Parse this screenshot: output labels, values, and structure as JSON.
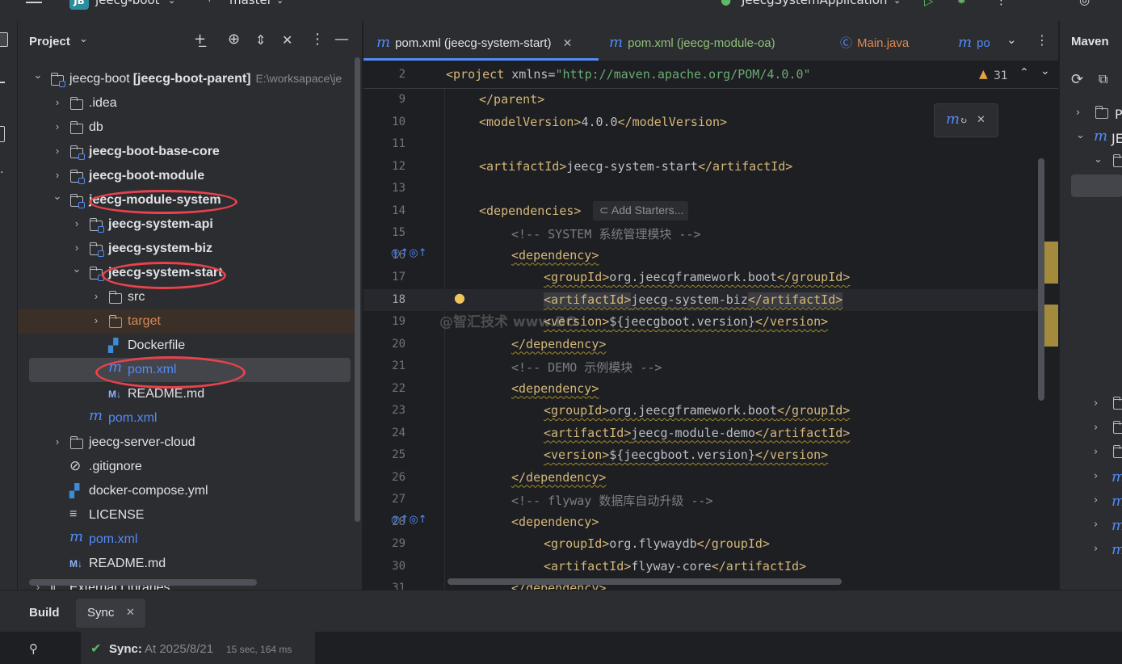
{
  "titlebar": {
    "project_badge": "JB",
    "project_name": "jeecg-boot",
    "branch": "master",
    "run_config": "JeecgSystemApplication"
  },
  "project_panel": {
    "title": "Project",
    "tree": [
      {
        "label": "jeecg-boot",
        "suffix": "[jeecg-boot-parent]",
        "path": "E:\\worksapace\\je",
        "depth": 0,
        "expanded": true,
        "icon": "module-folder-icon"
      },
      {
        "label": ".idea",
        "depth": 1,
        "expanded": false,
        "icon": "folder-icon"
      },
      {
        "label": "db",
        "depth": 1,
        "expanded": false,
        "icon": "folder-icon"
      },
      {
        "label": "jeecg-boot-base-core",
        "depth": 1,
        "expanded": false,
        "icon": "module-folder-icon",
        "bold": true
      },
      {
        "label": "jeecg-boot-module",
        "depth": 1,
        "expanded": false,
        "icon": "module-folder-icon",
        "bold": true
      },
      {
        "label": "jeecg-module-system",
        "depth": 1,
        "expanded": true,
        "icon": "module-folder-icon",
        "bold": true,
        "circled": true
      },
      {
        "label": "jeecg-system-api",
        "depth": 2,
        "expanded": false,
        "icon": "module-folder-icon",
        "bold": true
      },
      {
        "label": "jeecg-system-biz",
        "depth": 2,
        "expanded": false,
        "icon": "module-folder-icon",
        "bold": true
      },
      {
        "label": "jeecg-system-start",
        "depth": 2,
        "expanded": true,
        "icon": "module-folder-icon",
        "bold": true,
        "circled": true
      },
      {
        "label": "src",
        "depth": 3,
        "expanded": false,
        "icon": "folder-icon"
      },
      {
        "label": "target",
        "depth": 3,
        "expanded": false,
        "icon": "folder-icon",
        "excluded": true
      },
      {
        "label": "Dockerfile",
        "depth": 3,
        "icon": "docker-icon"
      },
      {
        "label": "pom.xml",
        "depth": 3,
        "icon": "maven-icon",
        "selected": true,
        "circled": true
      },
      {
        "label": "README.md",
        "depth": 3,
        "icon": "markdown-icon"
      },
      {
        "label": "pom.xml",
        "depth": 2,
        "icon": "maven-icon"
      },
      {
        "label": "jeecg-server-cloud",
        "depth": 1,
        "expanded": false,
        "icon": "folder-icon"
      },
      {
        "label": ".gitignore",
        "depth": 1,
        "icon": "ignore-icon"
      },
      {
        "label": "docker-compose.yml",
        "depth": 1,
        "icon": "docker-icon"
      },
      {
        "label": "LICENSE",
        "depth": 1,
        "icon": "text-icon"
      },
      {
        "label": "pom.xml",
        "depth": 1,
        "icon": "maven-icon"
      },
      {
        "label": "README.md",
        "depth": 1,
        "icon": "markdown-icon"
      },
      {
        "label": "External Libraries",
        "depth": 0,
        "expanded": false,
        "icon": "library-icon"
      }
    ]
  },
  "editor": {
    "tabs": [
      {
        "label": "pom.xml (jeecg-system-start)",
        "active": true,
        "icon": "maven-icon"
      },
      {
        "label": "pom.xml (jeecg-module-oa)",
        "icon": "maven-icon"
      },
      {
        "label": "Main.java",
        "icon": "java-class-icon"
      },
      {
        "label": "po",
        "icon": "maven-icon"
      }
    ],
    "warnings_count": "31",
    "sticky_line": {
      "number": "2",
      "text_tag_open": "<project ",
      "attr": "xmlns=",
      "value": "\"http://maven.apache.org/POM/4.0.0\""
    },
    "add_starters": "Add Starters...",
    "watermark": "@智汇技术  www.BO",
    "lines": [
      {
        "n": "9",
        "indent": 1,
        "parts": [
          [
            "tag",
            "</parent>"
          ]
        ]
      },
      {
        "n": "10",
        "indent": 1,
        "parts": [
          [
            "tag",
            "<modelVersion>"
          ],
          [
            "txt",
            "4.0.0"
          ],
          [
            "tag",
            "</modelVersion>"
          ]
        ]
      },
      {
        "n": "11",
        "indent": 0,
        "parts": []
      },
      {
        "n": "12",
        "indent": 1,
        "parts": [
          [
            "tag",
            "<artifactId>"
          ],
          [
            "txt",
            "jeecg-system-start"
          ],
          [
            "tag",
            "</artifactId>"
          ]
        ]
      },
      {
        "n": "13",
        "indent": 0,
        "parts": []
      },
      {
        "n": "14",
        "indent": 1,
        "parts": [
          [
            "tag",
            "<dependencies>"
          ]
        ],
        "starters": true
      },
      {
        "n": "15",
        "indent": 2,
        "parts": [
          [
            "cm",
            "<!-- SYSTEM 系统管理模块 -->"
          ]
        ]
      },
      {
        "n": "16",
        "indent": 2,
        "parts": [
          [
            "tag",
            "<dependency>"
          ]
        ],
        "gutter": true,
        "wavy": true
      },
      {
        "n": "17",
        "indent": 3,
        "parts": [
          [
            "tag",
            "<groupId>"
          ],
          [
            "txt",
            "org.jeecgframework.boot"
          ],
          [
            "tag",
            "</groupId>"
          ]
        ],
        "wavy": true
      },
      {
        "n": "18",
        "indent": 3,
        "parts": [
          [
            "tag",
            "<artifactId>"
          ],
          [
            "txt",
            "jeecg-system-biz"
          ],
          [
            "tag",
            "</artifactId>"
          ]
        ],
        "current": true,
        "wavy": true,
        "bulb": true
      },
      {
        "n": "19",
        "indent": 3,
        "parts": [
          [
            "tag",
            "<version>"
          ],
          [
            "txt",
            "${jeecgboot.version}"
          ],
          [
            "tag",
            "</version>"
          ]
        ],
        "wavy": true
      },
      {
        "n": "20",
        "indent": 2,
        "parts": [
          [
            "tag",
            "</dependency>"
          ]
        ],
        "wavy": true
      },
      {
        "n": "21",
        "indent": 2,
        "parts": [
          [
            "cm",
            "<!-- DEMO 示例模块 -->"
          ]
        ]
      },
      {
        "n": "22",
        "indent": 2,
        "parts": [
          [
            "tag",
            "<dependency>"
          ]
        ],
        "wavy": true
      },
      {
        "n": "23",
        "indent": 3,
        "parts": [
          [
            "tag",
            "<groupId>"
          ],
          [
            "txt",
            "org.jeecgframework.boot"
          ],
          [
            "tag",
            "</groupId>"
          ]
        ],
        "wavy": true
      },
      {
        "n": "24",
        "indent": 3,
        "parts": [
          [
            "tag",
            "<artifactId>"
          ],
          [
            "txt",
            "jeecg-module-demo"
          ],
          [
            "tag",
            "</artifactId>"
          ]
        ],
        "wavy": true
      },
      {
        "n": "25",
        "indent": 3,
        "parts": [
          [
            "tag",
            "<version>"
          ],
          [
            "txt",
            "${jeecgboot.version}"
          ],
          [
            "tag",
            "</version>"
          ]
        ],
        "wavy": true
      },
      {
        "n": "26",
        "indent": 2,
        "parts": [
          [
            "tag",
            "</dependency>"
          ]
        ],
        "wavy": true
      },
      {
        "n": "27",
        "indent": 2,
        "parts": [
          [
            "cm",
            "<!-- flyway 数据库自动升级 -->"
          ]
        ]
      },
      {
        "n": "28",
        "indent": 2,
        "parts": [
          [
            "tag",
            "<dependency>"
          ]
        ],
        "gutter": true
      },
      {
        "n": "29",
        "indent": 3,
        "parts": [
          [
            "tag",
            "<groupId>"
          ],
          [
            "txt",
            "org.flywaydb"
          ],
          [
            "tag",
            "</groupId>"
          ]
        ]
      },
      {
        "n": "30",
        "indent": 3,
        "parts": [
          [
            "tag",
            "<artifactId>"
          ],
          [
            "txt",
            "flyway-core"
          ],
          [
            "tag",
            "</artifactId>"
          ]
        ]
      },
      {
        "n": "31",
        "indent": 2,
        "parts": [
          [
            "tag",
            "</dependency>"
          ]
        ]
      }
    ]
  },
  "maven_panel": {
    "title": "Maven",
    "items": [
      "Pr",
      "JE"
    ]
  },
  "bottom": {
    "tabs": [
      {
        "label": "Build"
      },
      {
        "label": "Sync",
        "closable": true
      }
    ],
    "sync_status_label": "Sync:",
    "sync_status_text": "At 2025/8/21",
    "sync_duration": "15 sec, 164 ms"
  },
  "colors": {
    "accent": "#548af7",
    "tag": "#d5b778",
    "string": "#6aab73",
    "comment": "#7a7e85",
    "annotation": "#e8424c",
    "success": "#5fb865"
  }
}
